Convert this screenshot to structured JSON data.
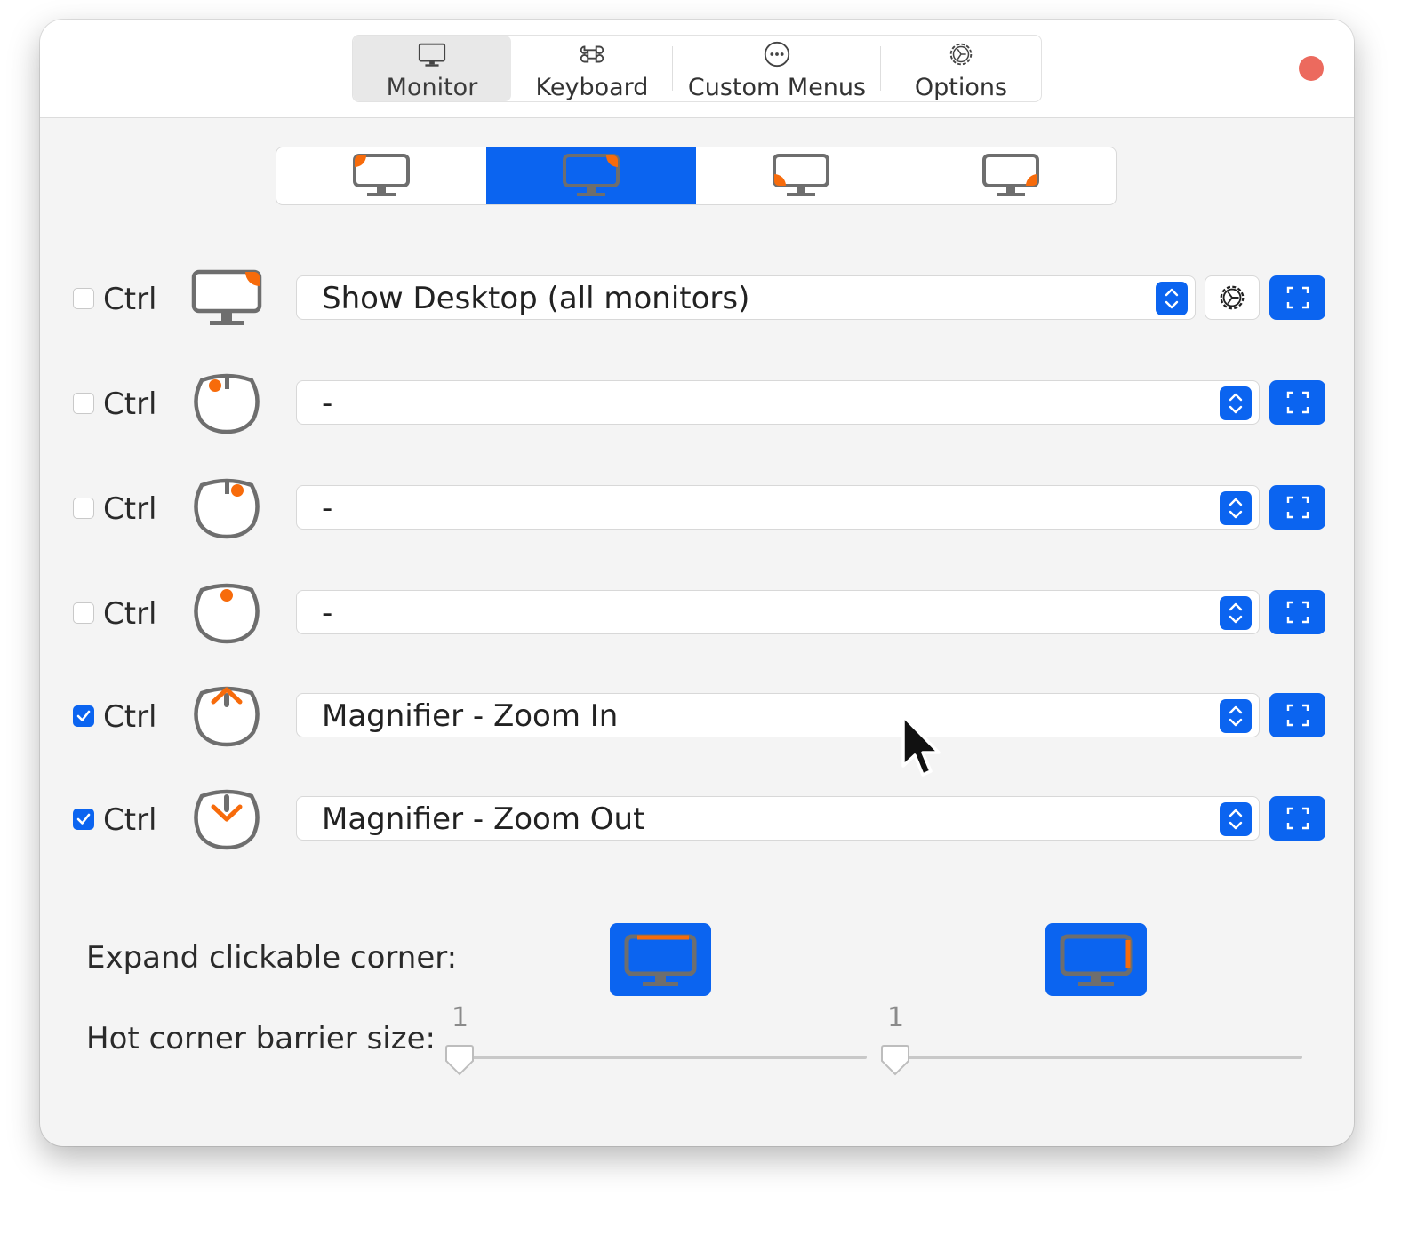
{
  "window": {
    "tabs": [
      {
        "label": "Monitor",
        "icon": "monitor-icon",
        "active": true
      },
      {
        "label": "Keyboard",
        "icon": "command-key-icon",
        "active": false
      },
      {
        "label": "Custom Menus",
        "icon": "ellipsis-circle-icon",
        "active": false
      },
      {
        "label": "Options",
        "icon": "gear-icon",
        "active": false
      }
    ]
  },
  "corners": {
    "options": [
      "top-left",
      "top-right",
      "bottom-left",
      "bottom-right"
    ],
    "selected": "top-right"
  },
  "rows": [
    {
      "checked": false,
      "modifier": "Ctrl",
      "trigger_icon": "monitor-corner-icon",
      "action": "Show Desktop (all monitors)",
      "has_settings": true
    },
    {
      "checked": false,
      "modifier": "Ctrl",
      "trigger_icon": "mouse-left-button-icon",
      "action": "-",
      "has_settings": false
    },
    {
      "checked": false,
      "modifier": "Ctrl",
      "trigger_icon": "mouse-right-button-icon",
      "action": "-",
      "has_settings": false
    },
    {
      "checked": false,
      "modifier": "Ctrl",
      "trigger_icon": "mouse-middle-button-icon",
      "action": "-",
      "has_settings": false
    },
    {
      "checked": true,
      "modifier": "Ctrl",
      "trigger_icon": "mouse-scroll-up-icon",
      "action": "Magnifier - Zoom In",
      "has_settings": false
    },
    {
      "checked": true,
      "modifier": "Ctrl",
      "trigger_icon": "mouse-scroll-down-icon",
      "action": "Magnifier - Zoom Out",
      "has_settings": false
    }
  ],
  "bottom": {
    "expand_label": "Expand clickable corner:",
    "barrier_label": "Hot corner barrier size:",
    "sliders": [
      {
        "value": "1",
        "level": 0
      },
      {
        "value": "1",
        "level": 0
      }
    ]
  },
  "colors": {
    "accent": "#0b64f0",
    "corner_orange": "#f76b0b",
    "close": "#ec6a5e"
  }
}
